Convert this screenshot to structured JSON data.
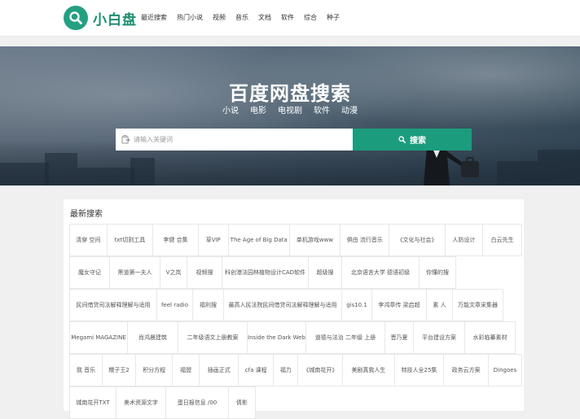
{
  "header": {
    "logo_text": "小白盘",
    "nav": [
      "最近搜索",
      "热门小说",
      "视频",
      "音乐",
      "文档",
      "软件",
      "综合",
      "种子"
    ]
  },
  "hero": {
    "title": "百度网盘搜索",
    "categories": [
      "小说",
      "电影",
      "电视剧",
      "软件",
      "动漫"
    ],
    "search_placeholder": "请输入关键词",
    "search_button": "搜索"
  },
  "recent": {
    "title": "最新搜索",
    "rows": [
      [
        "清穿 空间",
        "txt切割工具",
        "李健 合集",
        "草VIP",
        "The Age of Big Data",
        "单机游戏www",
        "俱由 流行音乐",
        "《文化与社会》",
        "人防设计",
        "白云先生"
      ],
      [
        "魔女守记",
        "黑道第一夫人",
        "V之岚",
        "视频搜",
        "科创港法园林植物设计CAD软件",
        "超级搜",
        "北京语言大学 德语初级",
        "你懂的搜"
      ],
      [
        "民间借贷司法解释理解与适用",
        "feel radio",
        "福利搜",
        "最高人民法院民间借贷司法解释理解与适用",
        "gis10.1",
        "李鸿章传 梁启超",
        "素 人",
        "万能文章采集器"
      ],
      [
        "Megami MAGAZINE",
        "肖鸿晨建筑",
        "二年级语文上册教案",
        "Inside the Dark Web",
        "道德与法治 二年级 上册",
        "晋乃夏",
        "平台建设方案",
        "水彩临摹素材"
      ],
      [
        "我 音乐",
        "糯子王2",
        "积分方程",
        "福盟",
        "插画正式",
        "cfa 课程",
        "福力",
        "《城南花开》",
        "美剧真我人生",
        "特技人全25集",
        "政务云方案",
        "Dingoes"
      ],
      [
        "城南花开TXT",
        "美术资源文字",
        "蛋日报信息 /00",
        "倩影"
      ]
    ],
    "widths": [
      [
        48,
        59,
        58,
        39,
        78,
        65,
        63,
        71,
        49,
        50
      ],
      [
        50,
        63,
        34,
        44,
        107,
        42,
        96,
        46
      ],
      [
        108,
        45,
        39,
        146,
        38,
        68,
        33,
        63
      ],
      [
        72,
        63,
        86,
        73,
        98,
        36,
        64,
        63
      ],
      [
        42,
        43,
        47,
        35,
        50,
        45,
        32,
        57,
        66,
        63,
        57,
        43
      ],
      [
        58,
        62,
        78,
        34
      ]
    ]
  }
}
